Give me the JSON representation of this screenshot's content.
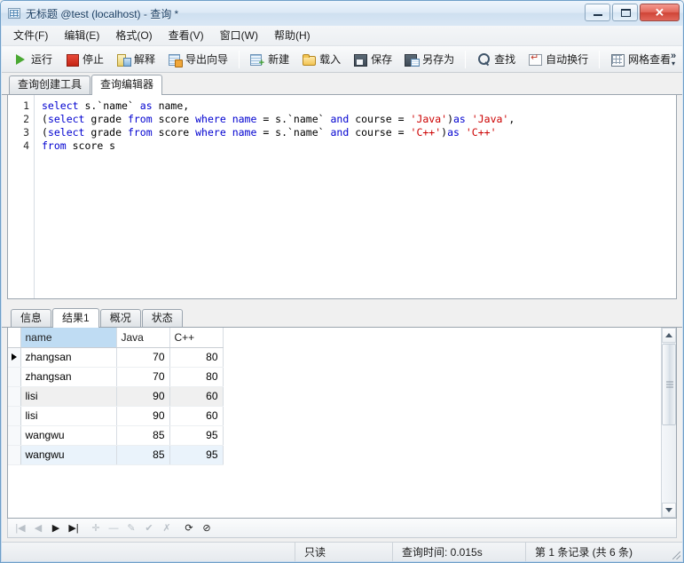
{
  "window": {
    "title": "无标题 @test (localhost) - 查询 *",
    "icon": "query-table-icon",
    "buttons": {
      "minimize": "minimize-button",
      "maximize": "maximize-button",
      "close": "✕"
    }
  },
  "menu": {
    "items": [
      {
        "label": "文件(F)",
        "name": "menu-file"
      },
      {
        "label": "编辑(E)",
        "name": "menu-edit"
      },
      {
        "label": "格式(O)",
        "name": "menu-format"
      },
      {
        "label": "查看(V)",
        "name": "menu-view"
      },
      {
        "label": "窗口(W)",
        "name": "menu-window"
      },
      {
        "label": "帮助(H)",
        "name": "menu-help"
      }
    ]
  },
  "toolbar": {
    "run": "运行",
    "stop": "停止",
    "explain": "解释",
    "export_wizard": "导出向导",
    "new": "新建",
    "load": "载入",
    "save": "保存",
    "save_as": "另存为",
    "find": "查找",
    "auto_wrap": "自动换行",
    "grid_view": "网格查看",
    "overflow": "»"
  },
  "editor_tabs": [
    {
      "label": "查询创建工具",
      "active": false
    },
    {
      "label": "查询编辑器",
      "active": true
    }
  ],
  "editor": {
    "line_numbers": [
      "1",
      "2",
      "3",
      "4"
    ],
    "lines": [
      [
        {
          "t": "select",
          "c": "kw"
        },
        {
          "t": " s.`name` ",
          "c": "pl"
        },
        {
          "t": "as",
          "c": "kw"
        },
        {
          "t": " name,",
          "c": "pl"
        }
      ],
      [
        {
          "t": "(",
          "c": "pl"
        },
        {
          "t": "select",
          "c": "kw"
        },
        {
          "t": " grade ",
          "c": "pl"
        },
        {
          "t": "from",
          "c": "kw"
        },
        {
          "t": " score ",
          "c": "pl"
        },
        {
          "t": "where",
          "c": "kw"
        },
        {
          "t": " ",
          "c": "pl"
        },
        {
          "t": "name",
          "c": "kw"
        },
        {
          "t": " = s.`name` ",
          "c": "pl"
        },
        {
          "t": "and",
          "c": "kw"
        },
        {
          "t": " course = ",
          "c": "pl"
        },
        {
          "t": "'Java'",
          "c": "str"
        },
        {
          "t": ")",
          "c": "pl"
        },
        {
          "t": "as",
          "c": "kw"
        },
        {
          "t": " ",
          "c": "pl"
        },
        {
          "t": "'Java'",
          "c": "str"
        },
        {
          "t": ",",
          "c": "pl"
        }
      ],
      [
        {
          "t": "(",
          "c": "pl"
        },
        {
          "t": "select",
          "c": "kw"
        },
        {
          "t": " grade ",
          "c": "pl"
        },
        {
          "t": "from",
          "c": "kw"
        },
        {
          "t": " score ",
          "c": "pl"
        },
        {
          "t": "where",
          "c": "kw"
        },
        {
          "t": " ",
          "c": "pl"
        },
        {
          "t": "name",
          "c": "kw"
        },
        {
          "t": " = s.`name` ",
          "c": "pl"
        },
        {
          "t": "and",
          "c": "kw"
        },
        {
          "t": " course = ",
          "c": "pl"
        },
        {
          "t": "'C++'",
          "c": "str"
        },
        {
          "t": ")",
          "c": "pl"
        },
        {
          "t": "as",
          "c": "kw"
        },
        {
          "t": " ",
          "c": "pl"
        },
        {
          "t": "'C++'",
          "c": "str"
        }
      ],
      [
        {
          "t": "from",
          "c": "kw"
        },
        {
          "t": " score s",
          "c": "pl"
        }
      ]
    ]
  },
  "result_tabs": [
    {
      "label": "信息",
      "active": false
    },
    {
      "label": "结果1",
      "active": true
    },
    {
      "label": "概况",
      "active": false
    },
    {
      "label": "状态",
      "active": false
    }
  ],
  "grid": {
    "columns": [
      "name",
      "Java",
      "C++"
    ],
    "selected_column": "name",
    "current_row": 0,
    "rows": [
      {
        "name": "zhangsan",
        "java": "70",
        "cpp": "80",
        "shade": "rowA"
      },
      {
        "name": "zhangsan",
        "java": "70",
        "cpp": "80",
        "shade": "rowA"
      },
      {
        "name": "lisi",
        "java": "90",
        "cpp": "60",
        "shade": "rowB"
      },
      {
        "name": "lisi",
        "java": "90",
        "cpp": "60",
        "shade": "rowA"
      },
      {
        "name": "wangwu",
        "java": "85",
        "cpp": "95",
        "shade": "rowA"
      },
      {
        "name": "wangwu",
        "java": "85",
        "cpp": "95",
        "shade": "rowC"
      }
    ]
  },
  "nav": {
    "buttons": [
      {
        "name": "first-record-button",
        "glyph": "|◀",
        "enabled": false
      },
      {
        "name": "previous-record-button",
        "glyph": "◀",
        "enabled": false
      },
      {
        "name": "next-record-button",
        "glyph": "▶",
        "enabled": true
      },
      {
        "name": "last-record-button",
        "glyph": "▶|",
        "enabled": true
      },
      {
        "name": "insert-record-button",
        "glyph": "✛",
        "enabled": false
      },
      {
        "name": "delete-record-button",
        "glyph": "—",
        "enabled": false
      },
      {
        "name": "edit-record-button",
        "glyph": "✎",
        "enabled": false
      },
      {
        "name": "apply-changes-button",
        "glyph": "✔",
        "enabled": false
      },
      {
        "name": "cancel-changes-button",
        "glyph": "✗",
        "enabled": false
      },
      {
        "name": "refresh-button",
        "glyph": "⟳",
        "enabled": true
      },
      {
        "name": "stop-loading-button",
        "glyph": "⊘",
        "enabled": true
      }
    ]
  },
  "status": {
    "readonly": "只读",
    "query_time": "查询时间: 0.015s",
    "record_info": "第 1 条记录 (共 6 条)"
  },
  "colors": {
    "keyword": "#0000d0",
    "string": "#cc0000",
    "header_selected": "#bfdcf3",
    "close_button": "#cf4436"
  }
}
